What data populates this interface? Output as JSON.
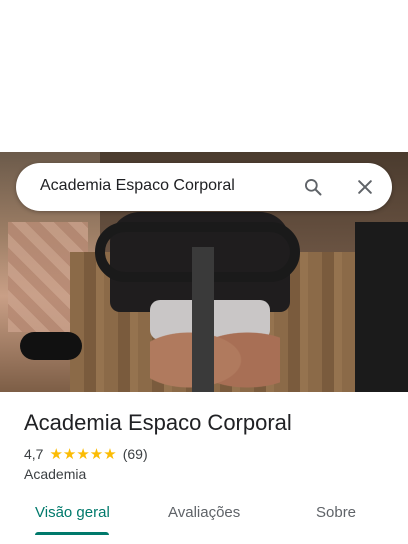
{
  "search": {
    "query": "Academia Espaco Corporal"
  },
  "place": {
    "title": "Academia Espaco Corporal",
    "rating": "4,7",
    "stars": "★★★★★",
    "review_count": "(69)",
    "category": "Academia"
  },
  "tabs": [
    {
      "label": "Visão geral",
      "active": true
    },
    {
      "label": "Avaliações"
    },
    {
      "label": "Sobre"
    }
  ],
  "colors": {
    "accent": "#00796b",
    "star": "#fbbc04"
  },
  "icons": {
    "search": "search-icon",
    "close": "close-icon"
  }
}
